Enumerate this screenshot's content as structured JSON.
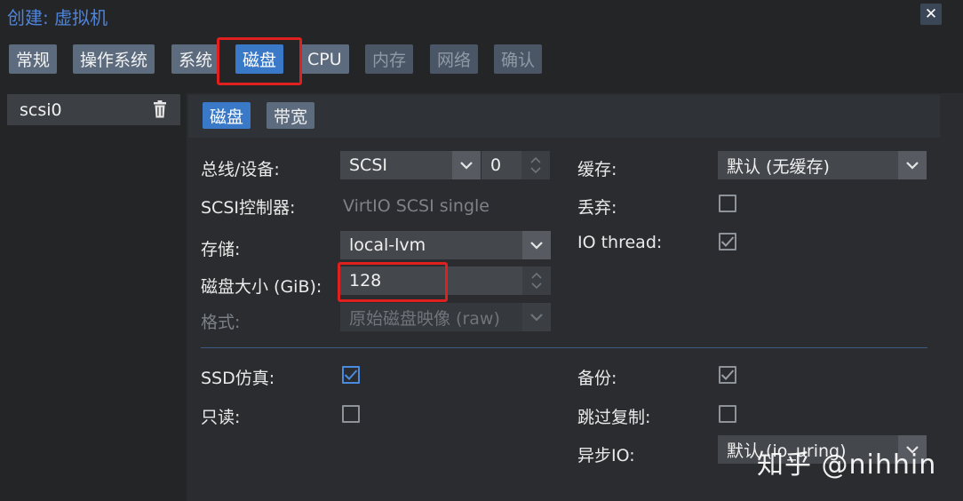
{
  "window": {
    "title": "创建: 虚拟机",
    "close_label": "✕"
  },
  "tabs": [
    {
      "label": "常规",
      "state": "enabled"
    },
    {
      "label": "操作系统",
      "state": "enabled"
    },
    {
      "label": "系统",
      "state": "enabled"
    },
    {
      "label": "磁盘",
      "state": "active"
    },
    {
      "label": "CPU",
      "state": "enabled"
    },
    {
      "label": "内存",
      "state": "disabled"
    },
    {
      "label": "网络",
      "state": "disabled"
    },
    {
      "label": "确认",
      "state": "disabled"
    }
  ],
  "disk_list": {
    "items": [
      {
        "label": "scsi0"
      }
    ]
  },
  "subtabs": [
    {
      "label": "磁盘",
      "state": "active"
    },
    {
      "label": "带宽",
      "state": "enabled"
    }
  ],
  "form": {
    "bus_label": "总线/设备:",
    "bus_value": "SCSI",
    "device_index": "0",
    "controller_label": "SCSI控制器:",
    "controller_value": "VirtIO SCSI single",
    "storage_label": "存储:",
    "storage_value": "local-lvm",
    "size_label": "磁盘大小 (GiB):",
    "size_value": "128",
    "format_label": "格式:",
    "format_value": "原始磁盘映像 (raw)",
    "cache_label": "缓存:",
    "cache_value": "默认 (无缓存)",
    "discard_label": "丢弃:",
    "discard_checked": false,
    "iothread_label": "IO thread:",
    "iothread_checked": true,
    "ssd_label": "SSD仿真:",
    "ssd_checked": true,
    "readonly_label": "只读:",
    "readonly_checked": false,
    "backup_label": "备份:",
    "backup_checked": true,
    "skip_replication_label": "跳过复制:",
    "skip_replication_checked": false,
    "async_io_label": "异步IO:",
    "async_io_value": "默认 (io_uring)"
  },
  "watermark": "知乎 @nihhin",
  "colors": {
    "accent": "#3a79c8",
    "highlight": "#e01f1f",
    "title": "#4f84d9"
  }
}
